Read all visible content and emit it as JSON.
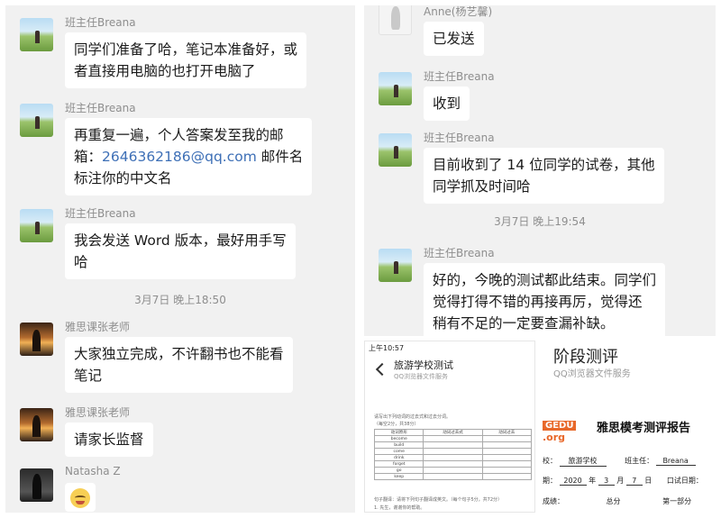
{
  "left_chat": {
    "messages": [
      {
        "sender": "班主任Breana",
        "lines": [
          "同学们准备了哈，笔记本准备好，或",
          "者直接用电脑的也打开电脑了"
        ]
      },
      {
        "sender": "班主任Breana",
        "lines": [
          "再重复一遍，个人答案发至我的邮",
          "箱：",
          "标注你的中文名"
        ],
        "email": "2646362186@qq.com",
        "after_email": " 邮件名"
      },
      {
        "sender": "班主任Breana",
        "lines": [
          "我会发送 Word 版本，最好用手写",
          "哈"
        ]
      },
      {
        "sender": "雅思课张老师",
        "lines": [
          "大家独立完成，不许翻书也不能看",
          "笔记"
        ]
      },
      {
        "sender": "雅思课张老师",
        "lines": [
          "请家长监督"
        ]
      },
      {
        "sender": "Natasha Z"
      }
    ],
    "timestamp": "3月7日 晚上18:50"
  },
  "right_chat": {
    "messages": [
      {
        "sender": "Anne(杨艺馨)",
        "lines": [
          "已发送"
        ]
      },
      {
        "sender": "班主任Breana",
        "lines": [
          "收到"
        ]
      },
      {
        "sender": "班主任Breana",
        "lines": [
          "目前收到了 14 位同学的试卷，其他",
          "同学抓及时间哈"
        ]
      },
      {
        "sender": "班主任Breana",
        "lines": [
          "好的，今晚的测试都此结束。同学们",
          "觉得打得不错的再接再厉，觉得还",
          "稍有不足的一定要查漏补缺。"
        ]
      }
    ],
    "timestamp": "3月7日 晚上19:54"
  },
  "doc_phone": {
    "status_time": "上午10:57",
    "title": "旅游学校测试",
    "subtitle": "QQ浏览器文件服务",
    "instructions": "请写出下列动词的过去式和过去分词。",
    "note": "（每空2分，共38分）",
    "table_headers": [
      "动词原形",
      "动词过去式",
      "动词过去"
    ],
    "verbs": [
      "become",
      "build",
      "come",
      "drink",
      "forget",
      "go",
      "keep"
    ],
    "footer_line": "句子翻译：请将下列句子翻译成英文。（每个句子5分，共72分）",
    "footer_line2": "1. 先生，谢谢你的帮助。"
  },
  "doc_report": {
    "title": "阶段测评",
    "subtitle": "QQ浏览器文件服务",
    "logo_top": "GEDU",
    "logo_bottom": ".org",
    "heading": "雅思模考测评报告",
    "row1_school_label": "校：",
    "row1_school": "旅游学校",
    "row1_teacher_label": "班主任：",
    "row1_teacher": "Breana",
    "row2_date_label": "期：",
    "row2_year": "2020",
    "row2_year_unit": "年",
    "row2_month": "3",
    "row2_month_unit": "月",
    "row2_day": "7",
    "row2_day_unit": "日",
    "row2_oral_label": "口试日期：",
    "row3_score_label": "成绩：",
    "row3_total": "总分",
    "row3_part1": "第一部分"
  }
}
